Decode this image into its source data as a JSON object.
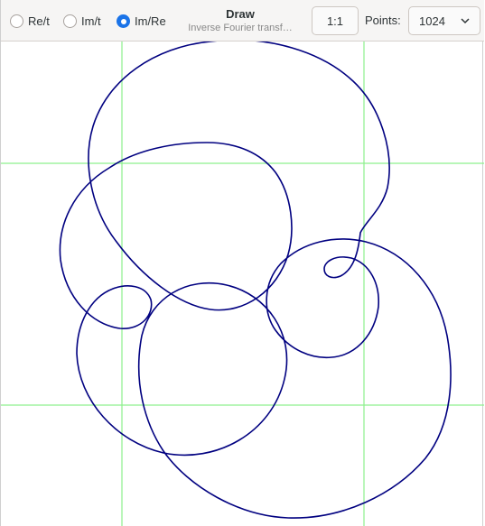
{
  "header": {
    "modes": [
      {
        "label": "Re/t",
        "checked": false
      },
      {
        "label": "Im/t",
        "checked": false
      },
      {
        "label": "Im/Re",
        "checked": true
      }
    ],
    "title": "Draw",
    "subtitle": "Inverse Fourier transf…",
    "ratio_button": "1:1",
    "points_label": "Points:",
    "points_value": "1024"
  },
  "plot": {
    "grid_color": "#8df08d",
    "curve_color": "#000080"
  }
}
